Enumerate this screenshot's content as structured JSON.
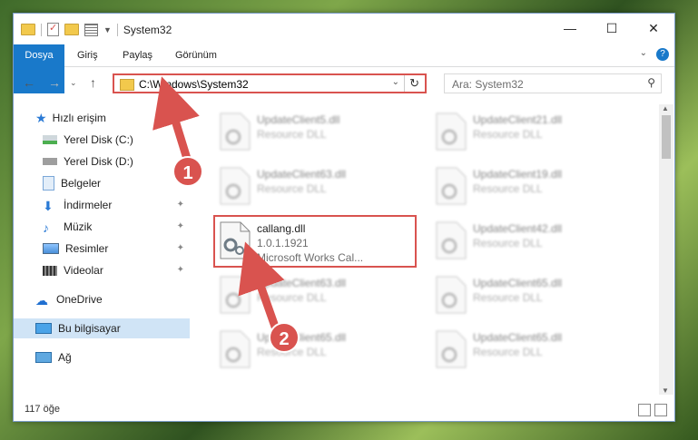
{
  "window": {
    "title": "System32"
  },
  "ribbon": {
    "tabs": [
      "Dosya",
      "Giriş",
      "Paylaş",
      "Görünüm"
    ],
    "help": "?"
  },
  "navbar": {
    "address": "C:\\Windows\\System32",
    "search_placeholder": "Ara: System32"
  },
  "sidebar": {
    "items": [
      {
        "label": "Hızlı erişim",
        "icon": "star-icon"
      },
      {
        "label": "Yerel Disk (C:)",
        "icon": "drive-icon"
      },
      {
        "label": "Yerel Disk (D:)",
        "icon": "drive-icon"
      },
      {
        "label": "Belgeler",
        "icon": "documents-icon"
      },
      {
        "label": "İndirmeler",
        "icon": "download-icon"
      },
      {
        "label": "Müzik",
        "icon": "music-icon"
      },
      {
        "label": "Resimler",
        "icon": "pictures-icon"
      },
      {
        "label": "Videolar",
        "icon": "videos-icon"
      },
      {
        "label": "OneDrive",
        "icon": "cloud-icon"
      },
      {
        "label": "Bu bilgisayar",
        "icon": "computer-icon"
      },
      {
        "label": "Ağ",
        "icon": "network-icon"
      }
    ]
  },
  "files": [
    {
      "name": "UpdateClient5.dll",
      "desc": "Resource DLL"
    },
    {
      "name": "UpdateClient21.dll",
      "desc": "Resource DLL"
    },
    {
      "name": "UpdateClient63.dll",
      "desc": "Resource DLL"
    },
    {
      "name": "UpdateClient19.dll",
      "desc": "Resource DLL"
    },
    {
      "name": "callang.dll",
      "desc": "1.0.1.1921",
      "desc2": "Microsoft Works Cal..."
    },
    {
      "name": "UpdateClient42.dll",
      "desc": "Resource DLL"
    },
    {
      "name": "UpdateClient63.dll",
      "desc": "Resource DLL"
    },
    {
      "name": "UpdateClient65.dll",
      "desc": "Resource DLL"
    },
    {
      "name": "UpdateClient65.dll",
      "desc": "Resource DLL"
    },
    {
      "name": "UpdateClient65.dll",
      "desc": "Resource DLL"
    }
  ],
  "status": {
    "count": "117 öğe"
  },
  "callouts": [
    "1",
    "2"
  ],
  "colors": {
    "accent": "#1979ca",
    "highlight": "#d9534f"
  }
}
